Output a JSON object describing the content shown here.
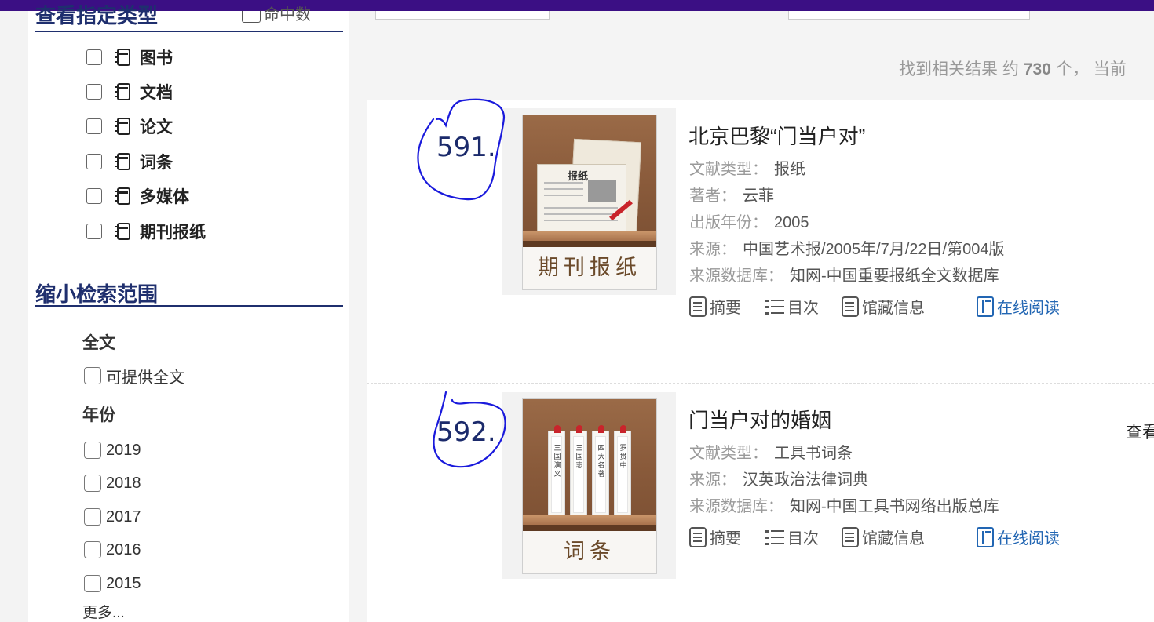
{
  "sidebar": {
    "type_section": {
      "title": "查看指定类型",
      "header_checkbox_label": "命中数",
      "items": [
        {
          "label": "图书"
        },
        {
          "label": "文档"
        },
        {
          "label": "论文"
        },
        {
          "label": "词条"
        },
        {
          "label": "多媒体"
        },
        {
          "label": "期刊报纸"
        }
      ]
    },
    "narrow_section": {
      "title": "缩小检索范围",
      "fulltext_title": "全文",
      "fulltext_option": "可提供全文",
      "year_title": "年份",
      "years": [
        "2019",
        "2018",
        "2017",
        "2016",
        "2015"
      ],
      "more": "更多..."
    }
  },
  "results_header": {
    "prefix": "找到相关结果 约",
    "count": "730",
    "suffix": "个， 当前"
  },
  "results": [
    {
      "number": "591.",
      "title": "北京巴黎“门当户对”",
      "thumb_caption": "期刊报纸",
      "thumb_paper_title": "报纸",
      "meta": [
        {
          "label": "文献类型：",
          "value": "报纸"
        },
        {
          "label": "著者：",
          "value": "云菲"
        },
        {
          "label": "出版年份：",
          "value": "2005"
        },
        {
          "label": "来源：",
          "value": "中国艺术报/2005年/7月/22日/第004版"
        },
        {
          "label": "来源数据库：",
          "value": "知网-中国重要报纸全文数据库"
        }
      ],
      "actions": {
        "abstract": "摘要",
        "toc": "目次",
        "holdings": "馆藏信息",
        "read_online": "在线阅读"
      }
    },
    {
      "number": "592.",
      "title": "门当户对的婚姻",
      "thumb_caption": "词条",
      "thumb_slips": [
        "三国演义",
        "三国志",
        "四大名著",
        "罗贯中"
      ],
      "meta": [
        {
          "label": "文献类型：",
          "value": "工具书词条"
        },
        {
          "label": "来源：",
          "value": "汉英政治法律词典"
        },
        {
          "label": "来源数据库：",
          "value": "知网-中国工具书网络出版总库"
        }
      ],
      "actions": {
        "abstract": "摘要",
        "toc": "目次",
        "holdings": "馆藏信息",
        "read_online": "在线阅读"
      },
      "side_link": "查看"
    }
  ],
  "colors": {
    "top_bar": "#3b0f84",
    "section_title": "#1f2f6e",
    "read_online": "#2266b3",
    "annotation_ink": "#1a1adc"
  }
}
